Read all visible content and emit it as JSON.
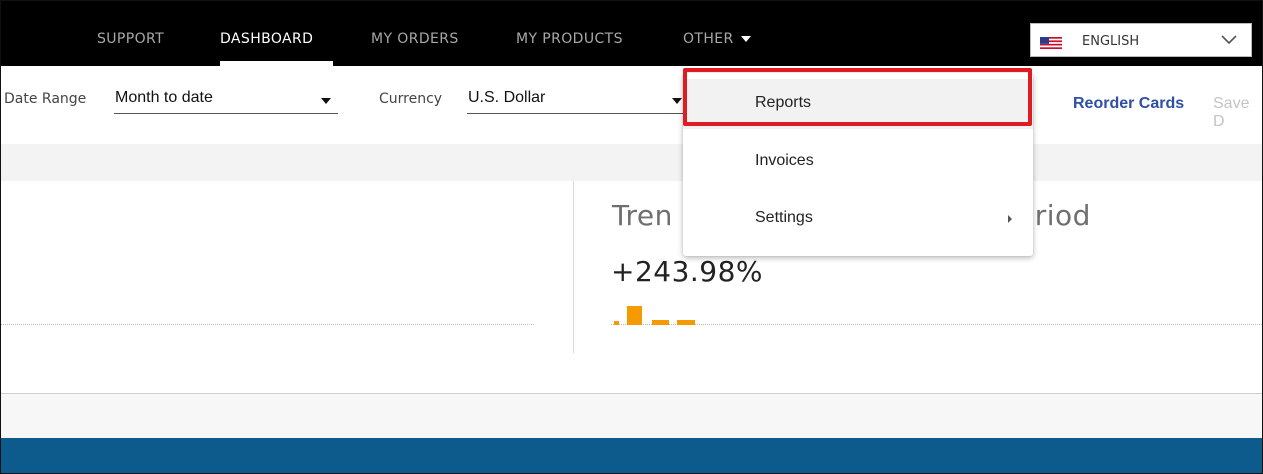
{
  "nav": {
    "items": [
      {
        "label": "SUPPORT",
        "active": false
      },
      {
        "label": "DASHBOARD",
        "active": true
      },
      {
        "label": "MY ORDERS",
        "active": false
      },
      {
        "label": "MY PRODUCTS",
        "active": false
      },
      {
        "label": "OTHER",
        "active": false,
        "icon": "caret-down-icon"
      }
    ],
    "language": {
      "label": "ENGLISH",
      "icon": "us-flag-icon"
    }
  },
  "filters": {
    "date_range": {
      "label": "Date Range",
      "value": "Month to date"
    },
    "currency": {
      "label": "Currency",
      "value": "U.S. Dollar"
    }
  },
  "actions": {
    "reorder_cards": "Reorder Cards",
    "save": "Save D"
  },
  "trend_card": {
    "title_start": "Tren",
    "title_end": "eriod",
    "value": "+243.98%",
    "sparkline_color": "#f59a00"
  },
  "menu": {
    "items": [
      {
        "label": "Reports",
        "highlighted": true
      },
      {
        "label": "Invoices",
        "highlighted": false
      },
      {
        "label": "Settings",
        "highlighted": false,
        "has_submenu": true
      }
    ]
  },
  "colors": {
    "topbar": "#000000",
    "link": "#2d4fa8",
    "footer": "#0d5a8d",
    "highlight_box": "#e11b22"
  }
}
